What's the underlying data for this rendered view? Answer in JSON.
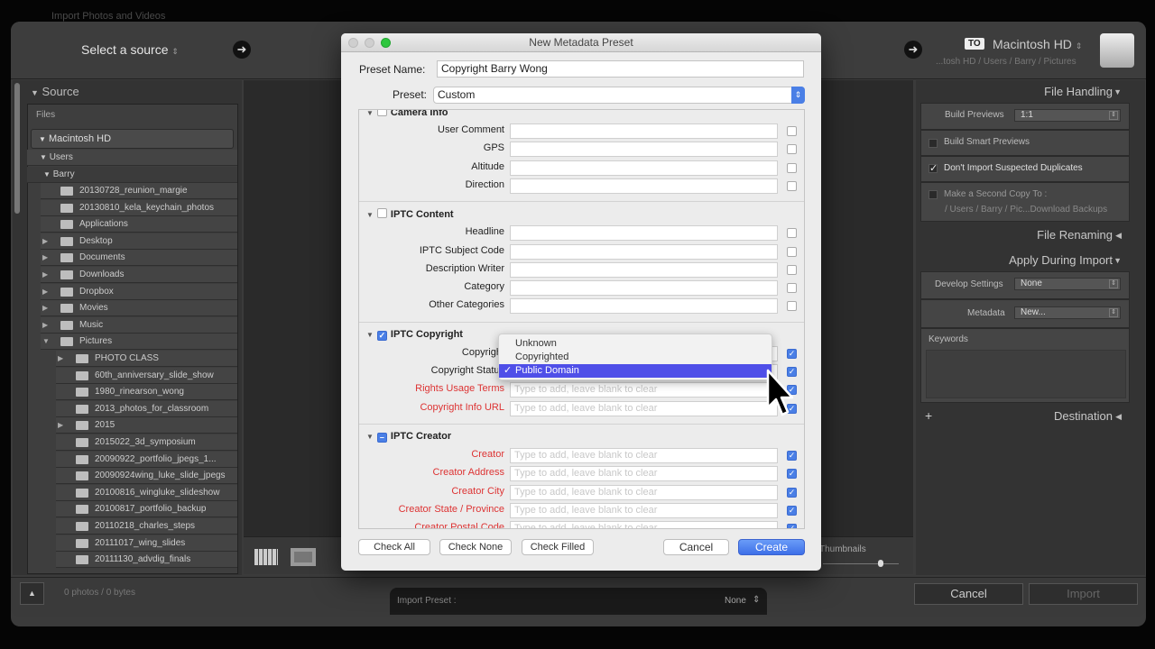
{
  "app_title": "Import Photos and Videos",
  "source": {
    "select_label": "Select a source",
    "panel_title": "Source",
    "files_label": "Files",
    "volume": "Macintosh HD",
    "users": "Users",
    "user": "Barry",
    "barry_items": [
      {
        "name": "20130728_reunion_margie",
        "expand": false
      },
      {
        "name": "20130810_kela_keychain_photos",
        "expand": false
      },
      {
        "name": "Applications",
        "expand": false
      },
      {
        "name": "Desktop",
        "expand": true
      },
      {
        "name": "Documents",
        "expand": true
      },
      {
        "name": "Downloads",
        "expand": true
      },
      {
        "name": "Dropbox",
        "expand": true
      },
      {
        "name": "Movies",
        "expand": true
      },
      {
        "name": "Music",
        "expand": true
      },
      {
        "name": "Pictures",
        "expand": "open"
      }
    ],
    "pictures_items": [
      {
        "name": "PHOTO CLASS",
        "expand": true
      },
      {
        "name": "60th_anniversary_slide_show",
        "expand": false
      },
      {
        "name": "1980_rinearson_wong",
        "expand": false
      },
      {
        "name": "2013_photos_for_classroom",
        "expand": false
      },
      {
        "name": "2015",
        "expand": true
      },
      {
        "name": "2015022_3d_symposium",
        "expand": false
      },
      {
        "name": "20090922_portfolio_jpegs_1...",
        "expand": false
      },
      {
        "name": "20090924wing_luke_slide_jpegs",
        "expand": false
      },
      {
        "name": "20100816_wingluke_slideshow",
        "expand": false
      },
      {
        "name": "20100817_portfolio_backup",
        "expand": false
      },
      {
        "name": "20110218_charles_steps",
        "expand": false
      },
      {
        "name": "20111017_wing_slides",
        "expand": false
      },
      {
        "name": "20111130_advdig_finals",
        "expand": false
      }
    ]
  },
  "destination": {
    "to_badge": "TO",
    "volume": "Macintosh HD",
    "path": "...tosh HD / Users / Barry / Pictures"
  },
  "right_panel": {
    "file_handling": "File Handling",
    "build_previews_label": "Build Previews",
    "build_previews_value": "1:1",
    "build_smart_previews": "Build Smart Previews",
    "dont_import_duplicates": "Don't Import Suspected Duplicates",
    "second_copy": "Make a Second Copy To :",
    "second_copy_path": "/ Users / Barry / Pic...Download Backups",
    "file_renaming": "File Renaming",
    "apply_during_import": "Apply During Import",
    "develop_settings_label": "Develop Settings",
    "develop_settings_value": "None",
    "metadata_label": "Metadata",
    "metadata_value": "New...",
    "keywords_label": "Keywords",
    "destination": "Destination"
  },
  "center_toolbar": {
    "thumbnails_label": "Thumbnails"
  },
  "bottom": {
    "status": "0 photos / 0 bytes",
    "import_preset_label": "Import Preset :",
    "import_preset_value": "None",
    "cancel": "Cancel",
    "import": "Import"
  },
  "dialog": {
    "title": "New Metadata Preset",
    "preset_name_label": "Preset Name:",
    "preset_name_value": "Copyright Barry Wong",
    "preset_label": "Preset:",
    "preset_value": "Custom",
    "placeholder": "Type to add, leave blank to clear",
    "sections": [
      {
        "title": "Camera Info",
        "state": "off",
        "fields": [
          {
            "label": "User Comment",
            "red": false,
            "placeholder": false,
            "checked": false
          },
          {
            "label": "GPS",
            "red": false,
            "placeholder": false,
            "checked": false
          },
          {
            "label": "Altitude",
            "red": false,
            "placeholder": false,
            "checked": false
          },
          {
            "label": "Direction",
            "red": false,
            "placeholder": false,
            "checked": false
          }
        ]
      },
      {
        "title": "IPTC Content",
        "state": "off",
        "fields": [
          {
            "label": "Headline",
            "red": false,
            "placeholder": false,
            "checked": false
          },
          {
            "label": "IPTC Subject Code",
            "red": false,
            "placeholder": false,
            "checked": false
          },
          {
            "label": "Description Writer",
            "red": false,
            "placeholder": false,
            "checked": false
          },
          {
            "label": "Category",
            "red": false,
            "placeholder": false,
            "checked": false
          },
          {
            "label": "Other Categories",
            "red": false,
            "placeholder": false,
            "checked": false
          }
        ]
      },
      {
        "title": "IPTC Copyright",
        "state": "on",
        "fields": [
          {
            "label": "Copyright",
            "red": false,
            "placeholder": false,
            "checked": true
          },
          {
            "label": "Copyright Status",
            "red": false,
            "placeholder": false,
            "checked": true
          },
          {
            "label": "Rights Usage Terms",
            "red": true,
            "placeholder": true,
            "checked": true
          },
          {
            "label": "Copyright Info URL",
            "red": true,
            "placeholder": true,
            "checked": true
          }
        ]
      },
      {
        "title": "IPTC Creator",
        "state": "mixed",
        "fields": [
          {
            "label": "Creator",
            "red": true,
            "placeholder": true,
            "checked": true
          },
          {
            "label": "Creator Address",
            "red": true,
            "placeholder": true,
            "checked": true
          },
          {
            "label": "Creator City",
            "red": true,
            "placeholder": true,
            "checked": true
          },
          {
            "label": "Creator State / Province",
            "red": true,
            "placeholder": true,
            "checked": true
          },
          {
            "label": "Creator Postal Code",
            "red": true,
            "placeholder": true,
            "checked": true
          }
        ]
      }
    ],
    "copyright_status_menu": {
      "options": [
        "Unknown",
        "Copyrighted",
        "Public Domain"
      ],
      "selected": "Public Domain"
    },
    "buttons": {
      "check_all": "Check All",
      "check_none": "Check None",
      "check_filled": "Check Filled",
      "cancel": "Cancel",
      "create": "Create"
    },
    "accent_color": "#3d7bf0"
  }
}
